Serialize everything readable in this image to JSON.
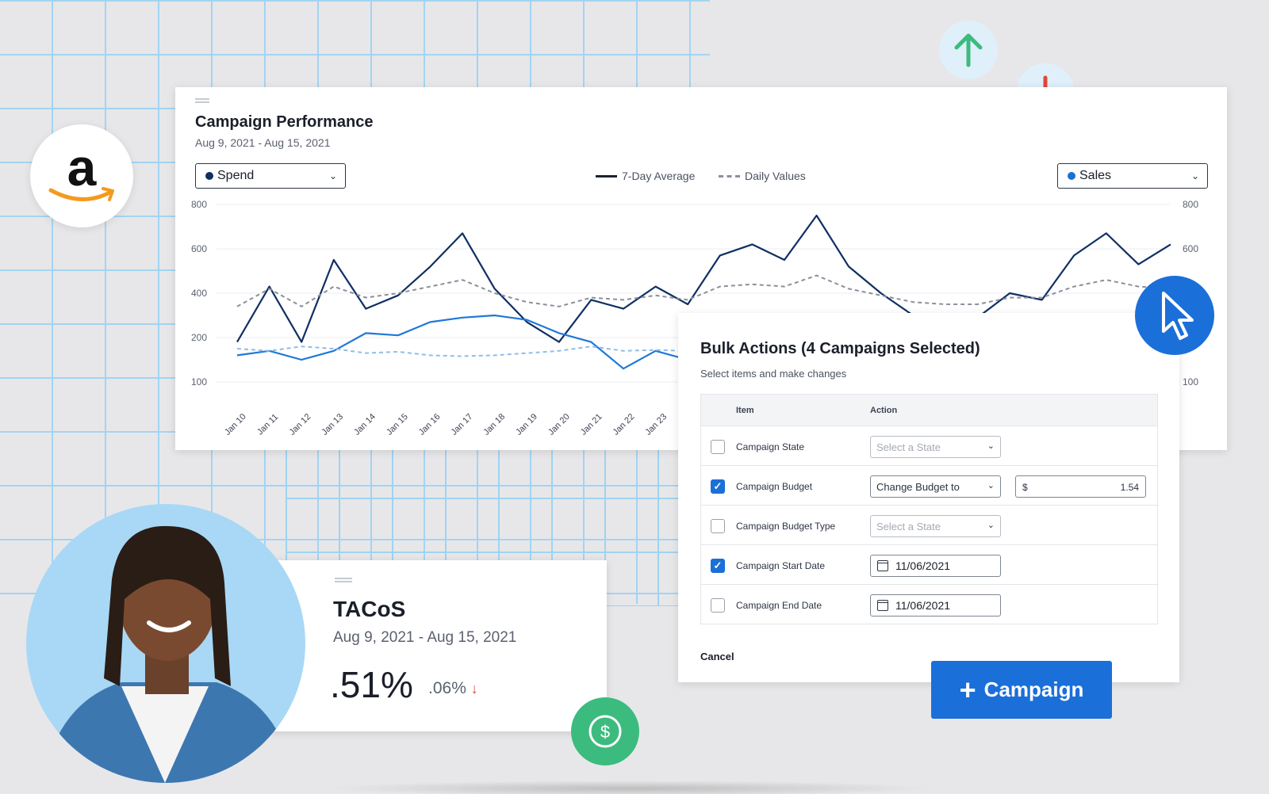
{
  "performance": {
    "title": "Campaign Performance",
    "date_range": "Aug 9, 2021 - Aug 15, 2021",
    "left_select": {
      "label": "Spend",
      "dot_color": "#0f2f63"
    },
    "right_select": {
      "label": "Sales",
      "dot_color": "#1b6fd8"
    },
    "legend": {
      "solid": "7-Day Average",
      "dashed": "Daily Values"
    }
  },
  "chart_data": {
    "type": "line",
    "x": [
      "Jan 10",
      "Jan 11",
      "Jan 12",
      "Jan 13",
      "Jan 14",
      "Jan 15",
      "Jan 16",
      "Jan 17",
      "Jan 18",
      "Jan 19",
      "Jan 20",
      "Jan 21",
      "Jan 22",
      "Jan 23"
    ],
    "y_ticks_left": [
      "800",
      "600",
      "400",
      "200",
      "100"
    ],
    "y_ticks_right": [
      "800",
      "600",
      "100"
    ],
    "series": [
      {
        "values": [
          190,
          430,
          190,
          550,
          330,
          390,
          520,
          670,
          420,
          270,
          190,
          370,
          330,
          430,
          350,
          570,
          620,
          550,
          750,
          520,
          400,
          300,
          280,
          290,
          400,
          370,
          570,
          670,
          530,
          620
        ],
        "color": "#0f2f63",
        "style": "solid"
      },
      {
        "values": [
          340,
          420,
          340,
          430,
          380,
          400,
          430,
          460,
          400,
          360,
          340,
          380,
          370,
          390,
          370,
          430,
          440,
          430,
          480,
          420,
          390,
          360,
          350,
          350,
          380,
          380,
          430,
          460,
          430,
          420
        ],
        "color": "#8a909b",
        "style": "dashed"
      },
      {
        "values": [
          160,
          170,
          150,
          170,
          220,
          210,
          270,
          290,
          300,
          280,
          220,
          190,
          130,
          170,
          150,
          160,
          180,
          200,
          200,
          190,
          180,
          170,
          170,
          180,
          190,
          190,
          200,
          210,
          200,
          200
        ],
        "color": "#1f78d8",
        "style": "solid"
      },
      {
        "values": [
          175,
          170,
          180,
          175,
          165,
          168,
          160,
          158,
          160,
          165,
          170,
          180,
          170,
          172,
          170,
          175,
          178,
          180,
          182,
          178,
          175,
          172,
          170,
          172,
          175,
          176,
          178,
          180,
          178,
          178
        ],
        "color": "#8fbde8",
        "style": "dashed"
      }
    ]
  },
  "bulk": {
    "title": "Bulk Actions (4 Campaigns Selected)",
    "subtitle": "Select items and make changes",
    "col_item": "Item",
    "col_action": "Action",
    "rows": [
      {
        "label": "Campaign State",
        "checked": false,
        "action": "Select a State"
      },
      {
        "label": "Campaign Budget",
        "checked": true,
        "action": "Change Budget to",
        "currency": "$",
        "amount": "1.54"
      },
      {
        "label": "Campaign Budget Type",
        "checked": false,
        "action": "Select a State"
      },
      {
        "label": "Campaign Start Date",
        "checked": true,
        "date": "11/06/2021"
      },
      {
        "label": "Campaign End Date",
        "checked": false,
        "date": "11/06/2021"
      }
    ],
    "cancel": "Cancel"
  },
  "campaign_button": {
    "plus": "+",
    "label": "Campaign"
  },
  "tacos": {
    "title": "TACoS",
    "date_range": "Aug 9, 2021 - Aug 15, 2021",
    "value": ".51%",
    "delta": ".06%",
    "delta_arrow": "↓"
  },
  "amazon_logo": {
    "letter": "a"
  },
  "colors": {
    "accent": "#1b6fd8",
    "up": "#3cbb7e",
    "down": "#e0473c",
    "navy": "#0f2f63"
  }
}
